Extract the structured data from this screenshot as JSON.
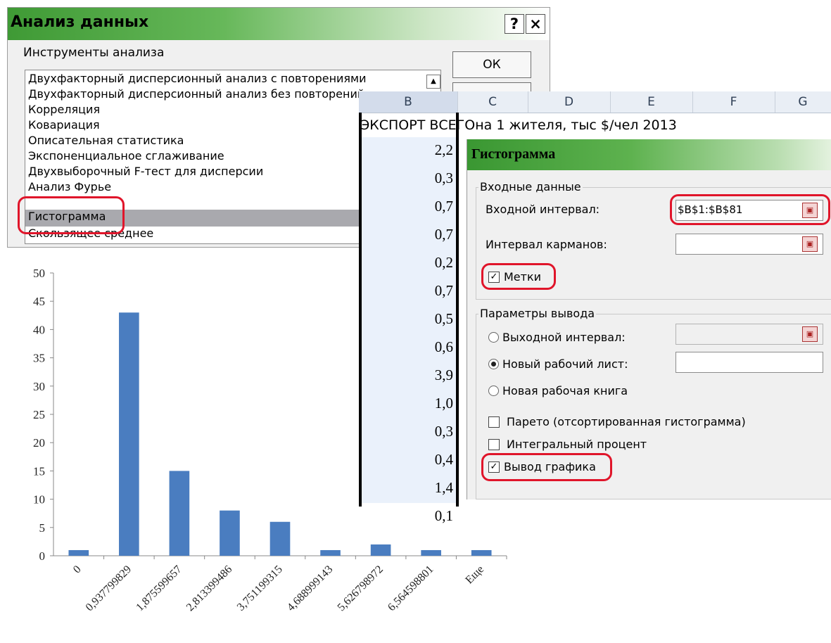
{
  "analysis_dialog": {
    "title": "Анализ данных",
    "help_label": "?",
    "close_label": "×",
    "tools_label": "Инструменты анализа",
    "tools": [
      "Двухфакторный дисперсионный анализ с повторениями",
      "Двухфакторный дисперсионный анализ без повторений",
      "Корреляция",
      "Ковариация",
      "Описательная статистика",
      "Экспоненциальное сглаживание",
      "Двухвыборочный F-тест для дисперсии",
      "Анализ Фурье",
      "Гистограмма",
      "Скользящее среднее"
    ],
    "selected_tool": "Гистограмма",
    "ok_label": "ОК"
  },
  "sheet": {
    "columns": [
      "B",
      "C",
      "D",
      "E",
      "F",
      "G"
    ],
    "header_text": "ЭКСПОРТ ВСЕГОна 1 жителя, тыс $/чел 2013",
    "column_b_values": [
      "2,2",
      "0,3",
      "0,7",
      "0,7",
      "0,2",
      "0,7",
      "0,5",
      "0,6",
      "3,9",
      "1,0",
      "0,3",
      "0,4",
      "1,4",
      "0,1"
    ]
  },
  "histogram_dialog": {
    "title": "Гистограмма",
    "input_group_label": "Входные данные",
    "input_range_label": "Входной интервал:",
    "input_range_value": "$B$1:$B$81",
    "bin_range_label": "Интервал карманов:",
    "bin_range_value": "",
    "labels_label": "Метки",
    "labels_checked": true,
    "output_group_label": "Параметры вывода",
    "output_range_label": "Выходной интервал:",
    "new_sheet_label": "Новый рабочий лист:",
    "new_workbook_label": "Новая рабочая книга",
    "selected_output": "new_sheet",
    "pareto_label": "Парето (отсортированная гистограмма)",
    "pareto_checked": false,
    "cumulative_label": "Интегральный процент",
    "cumulative_checked": false,
    "chart_output_label": "Вывод графика",
    "chart_output_checked": true
  },
  "colors": {
    "bar": "#4a7dc0",
    "highlight": "#e0152a",
    "title_green": "#3f9a35"
  },
  "chart_data": {
    "type": "bar",
    "categories": [
      "0",
      "0,937799829",
      "1,875599657",
      "2,813399486",
      "3,751199315",
      "4,688999143",
      "5,626798972",
      "6,564598801",
      "Еще"
    ],
    "values": [
      1,
      43,
      15,
      8,
      6,
      1,
      2,
      1,
      1
    ],
    "ylim": [
      0,
      50
    ],
    "yticks": [
      0,
      5,
      10,
      15,
      20,
      25,
      30,
      35,
      40,
      45,
      50
    ],
    "grid": false,
    "legend": "none"
  }
}
